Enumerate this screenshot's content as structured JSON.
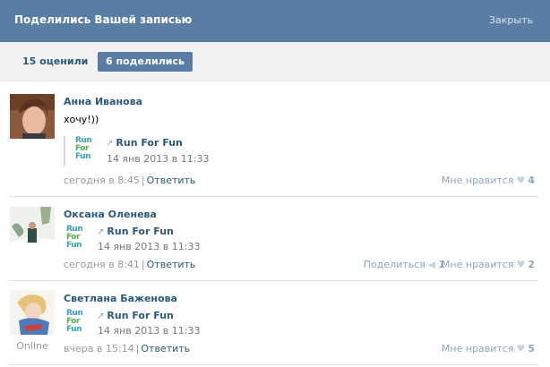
{
  "header": {
    "title": "Поделились Вашей записью",
    "close_label": "Закрыть"
  },
  "tabs": {
    "likes": "15 оценили",
    "shares": "6 поделились"
  },
  "repost_logo": {
    "line1": "Run",
    "line2": "For",
    "line3": "Fun"
  },
  "posts": [
    {
      "author": "Анна Иванова",
      "text": "хочу!))",
      "repost_title": "Run For Fun",
      "repost_date": "14 янв 2013 в 11:33",
      "time": "сегодня в 8:45",
      "reply": "Ответить",
      "like_label": "Мне нравится",
      "like_count": "4"
    },
    {
      "author": "Оксана Оленева",
      "repost_title": "Run For Fun",
      "repost_date": "14 янв 2013 в 11:33",
      "time": "сегодня в 8:41",
      "reply": "Ответить",
      "share_label": "Поделиться",
      "share_count": "1",
      "like_label": "Мне нравится",
      "like_count": "2"
    },
    {
      "author": "Светлана Баженова",
      "online": "Online",
      "repost_title": "Run For Fun",
      "repost_date": "14 янв 2013 в 11:33",
      "time": "вчера в 15:14",
      "reply": "Ответить",
      "like_label": "Мне нравится",
      "like_count": "5"
    }
  ],
  "icons": {
    "repost": "share-arrow-icon",
    "heart": "heart-icon",
    "share": "megaphone-icon"
  },
  "colors": {
    "header_bg": "#597da3",
    "link": "#2b587a",
    "muted": "#999999",
    "logo_blue": "#3a9fb5",
    "logo_green": "#5bab5a"
  }
}
